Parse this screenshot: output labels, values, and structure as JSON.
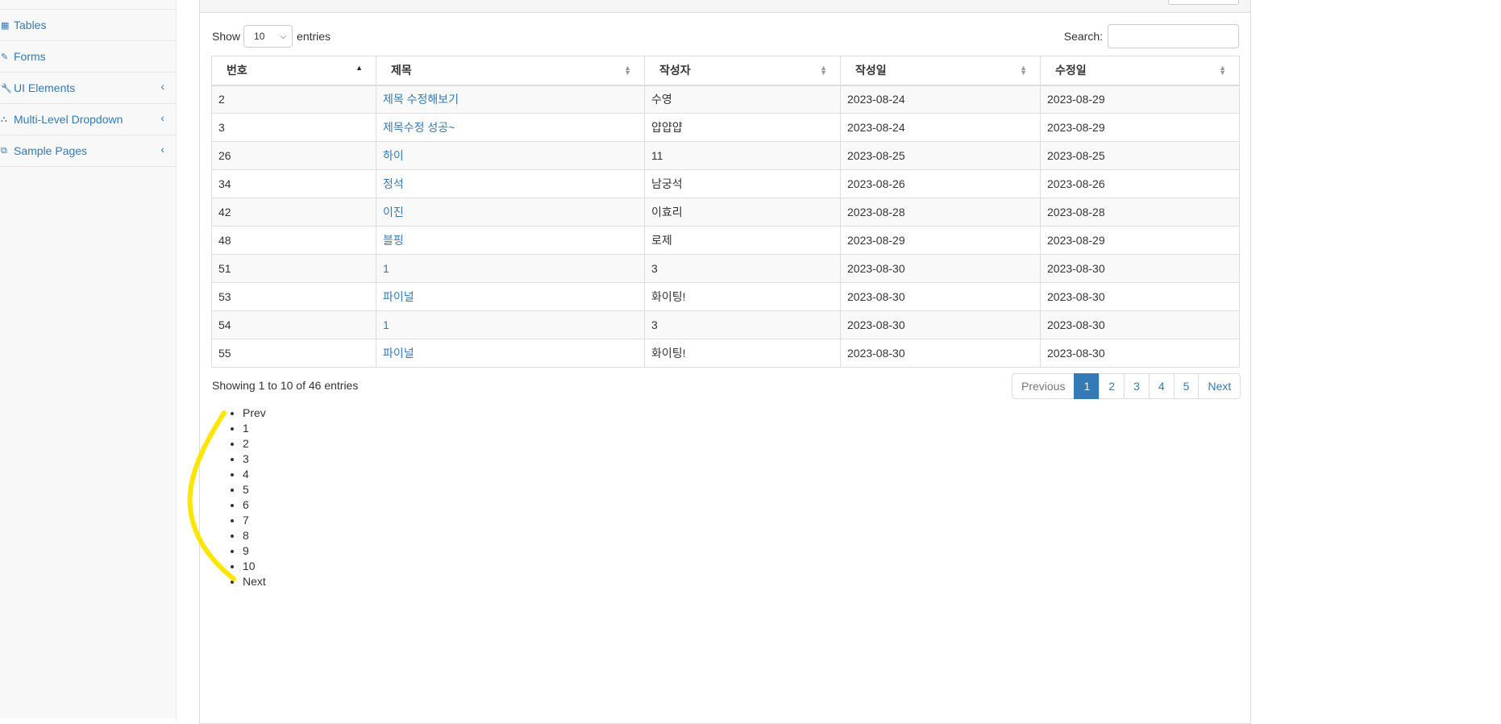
{
  "sidebar": {
    "items": [
      {
        "label": "",
        "icon": "",
        "has_caret": false
      },
      {
        "label": "Tables",
        "icon": "table-icon",
        "glyph": "▦",
        "has_caret": false
      },
      {
        "label": "Forms",
        "icon": "edit-icon",
        "glyph": "✎",
        "has_caret": false
      },
      {
        "label": "UI Elements",
        "icon": "wrench-icon",
        "glyph": "🔧",
        "has_caret": true
      },
      {
        "label": "Multi-Level Dropdown",
        "icon": "sitemap-icon",
        "glyph": "⛬",
        "has_caret": true
      },
      {
        "label": "Sample Pages",
        "icon": "files-icon",
        "glyph": "⧉",
        "has_caret": true
      }
    ],
    "caret": "‹"
  },
  "controls": {
    "show_label": "Show",
    "page_size": "10",
    "entries_label": "entries",
    "search_label": "Search:",
    "search_value": ""
  },
  "table": {
    "columns": [
      "번호",
      "제목",
      "작성자",
      "작성일",
      "수정일"
    ],
    "rows": [
      [
        "2",
        "제목 수정해보기",
        "수영",
        "2023-08-24",
        "2023-08-29"
      ],
      [
        "3",
        "제목수정 성공~",
        "얍얍얍",
        "2023-08-24",
        "2023-08-29"
      ],
      [
        "26",
        "하이",
        "11",
        "2023-08-25",
        "2023-08-25"
      ],
      [
        "34",
        "정석",
        "남궁석",
        "2023-08-26",
        "2023-08-26"
      ],
      [
        "42",
        "이진",
        "이효리",
        "2023-08-28",
        "2023-08-28"
      ],
      [
        "48",
        "블핑",
        "로제",
        "2023-08-29",
        "2023-08-29"
      ],
      [
        "51",
        "1",
        "3",
        "2023-08-30",
        "2023-08-30"
      ],
      [
        "53",
        "파이널",
        "화이팅!",
        "2023-08-30",
        "2023-08-30"
      ],
      [
        "54",
        "1",
        "3",
        "2023-08-30",
        "2023-08-30"
      ],
      [
        "55",
        "파이널",
        "화이팅!",
        "2023-08-30",
        "2023-08-30"
      ]
    ]
  },
  "info": "Showing 1 to 10 of 46 entries",
  "pagination": {
    "previous": "Previous",
    "pages": [
      "1",
      "2",
      "3",
      "4",
      "5"
    ],
    "active": "1",
    "next": "Next"
  },
  "plain_list": [
    "Prev",
    "1",
    "2",
    "3",
    "4",
    "5",
    "6",
    "7",
    "8",
    "9",
    "10",
    "Next"
  ],
  "colors": {
    "link": "#337ab7",
    "highlight": "#ffe600"
  }
}
